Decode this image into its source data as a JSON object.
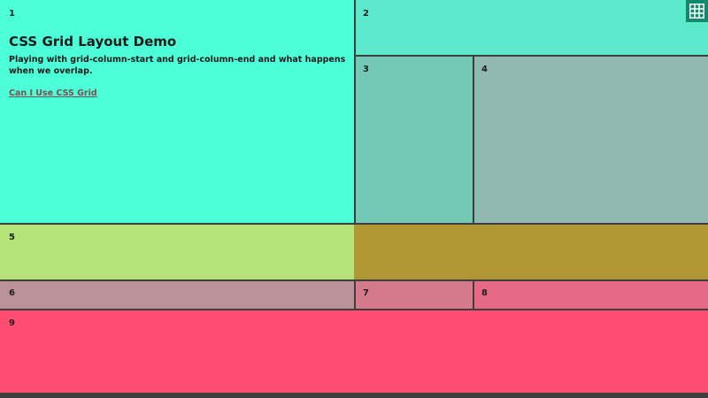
{
  "cells": [
    {
      "num": "1"
    },
    {
      "num": "2"
    },
    {
      "num": "3"
    },
    {
      "num": "4"
    },
    {
      "num": "5"
    },
    {
      "num": "6"
    },
    {
      "num": "7"
    },
    {
      "num": "8"
    },
    {
      "num": "9"
    }
  ],
  "intro": {
    "title": "CSS Grid Layout Demo",
    "description": "Playing with grid-column-start and grid-column-end and what happens when we overlap.",
    "link_label": "Can I Use CSS Grid"
  },
  "grid_button": {
    "icon": "grid-icon",
    "color": "#0f8a6c"
  },
  "colors": {
    "cell1": "#4dffd8",
    "cell2": "#5de9cb",
    "cell3": "#74c9b6",
    "cell4": "#8fb9b1",
    "cell5": "#b6e378",
    "overlap": "#b19636",
    "cell6": "#bb929a",
    "cell7": "#d47a8a",
    "cell8": "#e66985",
    "cell9": "#ff4c71"
  }
}
